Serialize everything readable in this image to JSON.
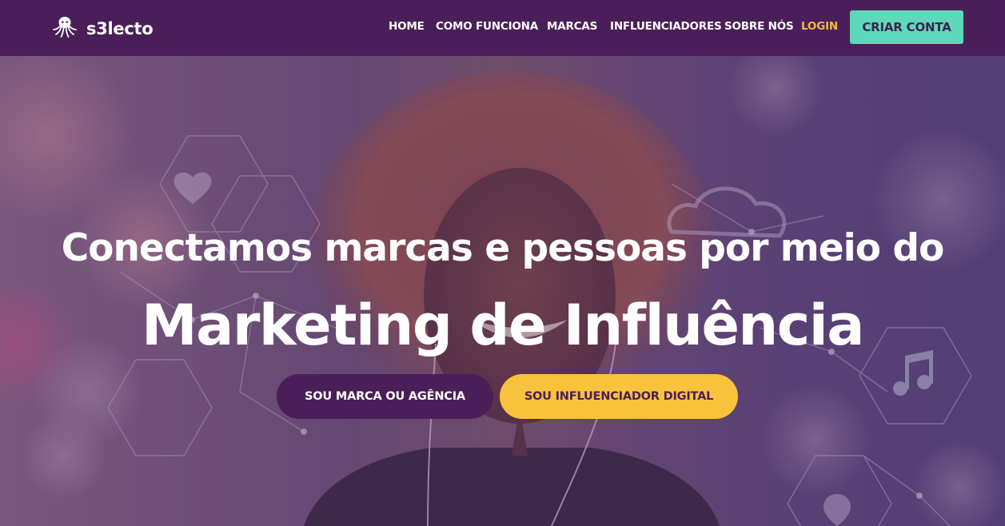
{
  "brand": {
    "name": "s3lecto",
    "logo_icon": "octopus-icon"
  },
  "nav": {
    "items": [
      {
        "label": "HOME"
      },
      {
        "label": "COMO FUNCIONA"
      },
      {
        "label": "MARCAS"
      },
      {
        "label": "INFLUENCIADORES"
      },
      {
        "label": "SOBRE NÓS"
      }
    ],
    "login_label": "LOGIN",
    "cta_label": "CRIAR CONTA"
  },
  "hero": {
    "title_line1": "Conectamos marcas e pessoas por meio do",
    "title_line2": "Marketing de Influência",
    "buttons": {
      "brand_label": "SOU MARCA OU AGÊNCIA",
      "influencer_label": "SOU INFLUENCIADOR DIGITAL"
    }
  },
  "colors": {
    "nav_bg": "#4a1f59",
    "accent_teal": "#5dd8b9",
    "accent_yellow": "#f8c23c",
    "login_color": "#f3b939"
  }
}
